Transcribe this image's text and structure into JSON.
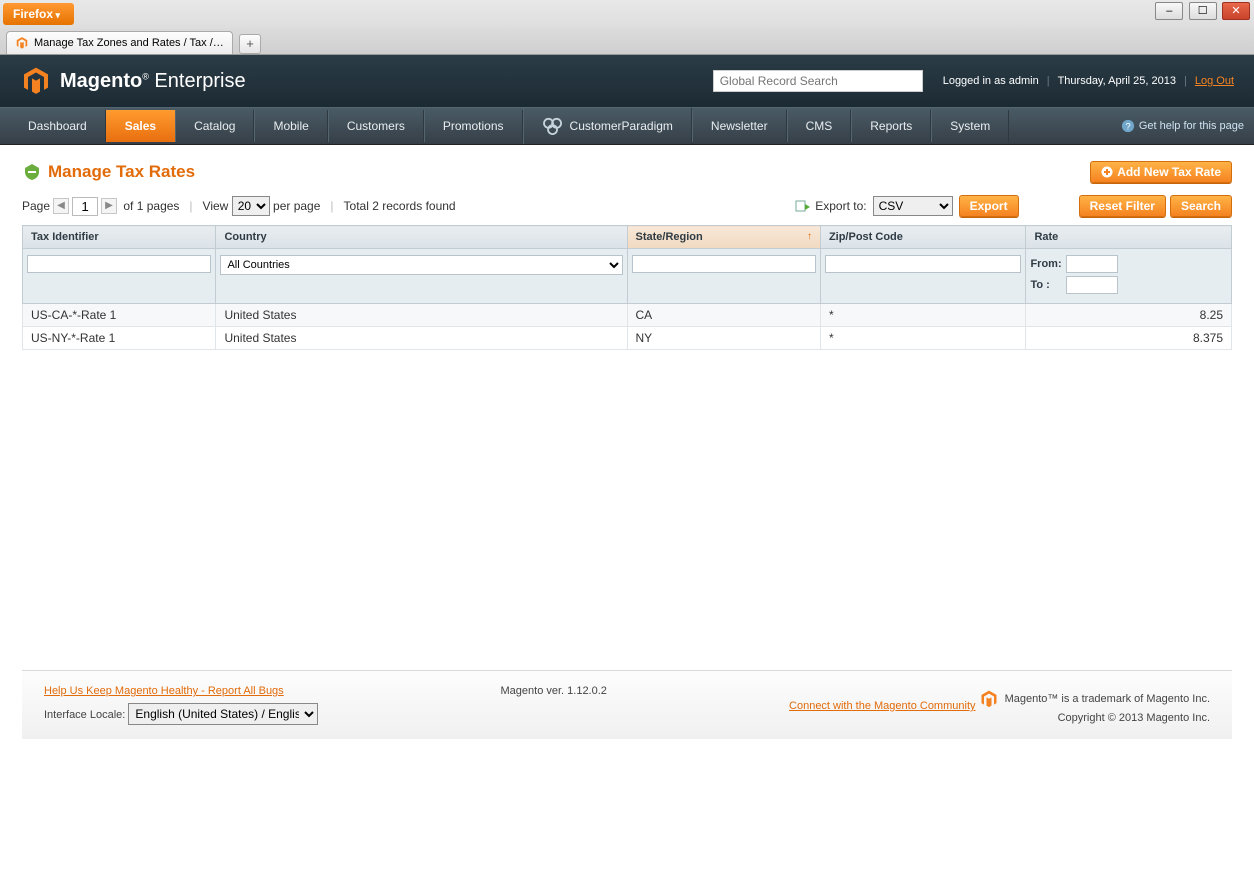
{
  "browser": {
    "firefox_label": "Firefox",
    "tab_title": "Manage Tax Zones and Rates / Tax / Sale...",
    "new_tab": "+"
  },
  "header": {
    "brand": "Magento",
    "brand_suffix": "Enterprise",
    "search_placeholder": "Global Record Search",
    "logged_in_text": "Logged in as admin",
    "date_text": "Thursday, April 25, 2013",
    "logout": "Log Out"
  },
  "nav": {
    "items": [
      "Dashboard",
      "Sales",
      "Catalog",
      "Mobile",
      "Customers",
      "Promotions",
      "CustomerParadigm",
      "Newsletter",
      "CMS",
      "Reports",
      "System"
    ],
    "active_index": 1,
    "help_text": "Get help for this page"
  },
  "page": {
    "title": "Manage Tax Rates",
    "add_button": "Add New Tax Rate"
  },
  "pager": {
    "page_label": "Page",
    "current_page": "1",
    "of_pages_text": "of 1 pages",
    "view_label": "View",
    "per_page_value": "20",
    "per_page_text": "per page",
    "total_text": "Total 2 records found",
    "export_label": "Export to:",
    "export_format": "CSV",
    "export_button": "Export",
    "reset_button": "Reset Filter",
    "search_button": "Search"
  },
  "grid": {
    "columns": {
      "tax_identifier": "Tax Identifier",
      "country": "Country",
      "state_region": "State/Region",
      "zip": "Zip/Post Code",
      "rate": "Rate"
    },
    "filter": {
      "country_value": "All Countries",
      "rate_from_label": "From:",
      "rate_to_label": "To :"
    },
    "rows": [
      {
        "tax_identifier": "US-CA-*-Rate 1",
        "country": "United States",
        "state": "CA",
        "zip": "*",
        "rate": "8.25"
      },
      {
        "tax_identifier": "US-NY-*-Rate 1",
        "country": "United States",
        "state": "NY",
        "zip": "*",
        "rate": "8.375"
      }
    ]
  },
  "footer": {
    "report_bugs": "Help Us Keep Magento Healthy - Report All Bugs",
    "locale_label": "Interface Locale:",
    "locale_value": "English (United States) / English",
    "version_text": "Magento ver. 1.12.0.2",
    "community_link": "Connect with the Magento Community",
    "trademark": "Magento™ is a trademark of Magento Inc.",
    "copyright": "Copyright © 2013 Magento Inc."
  }
}
